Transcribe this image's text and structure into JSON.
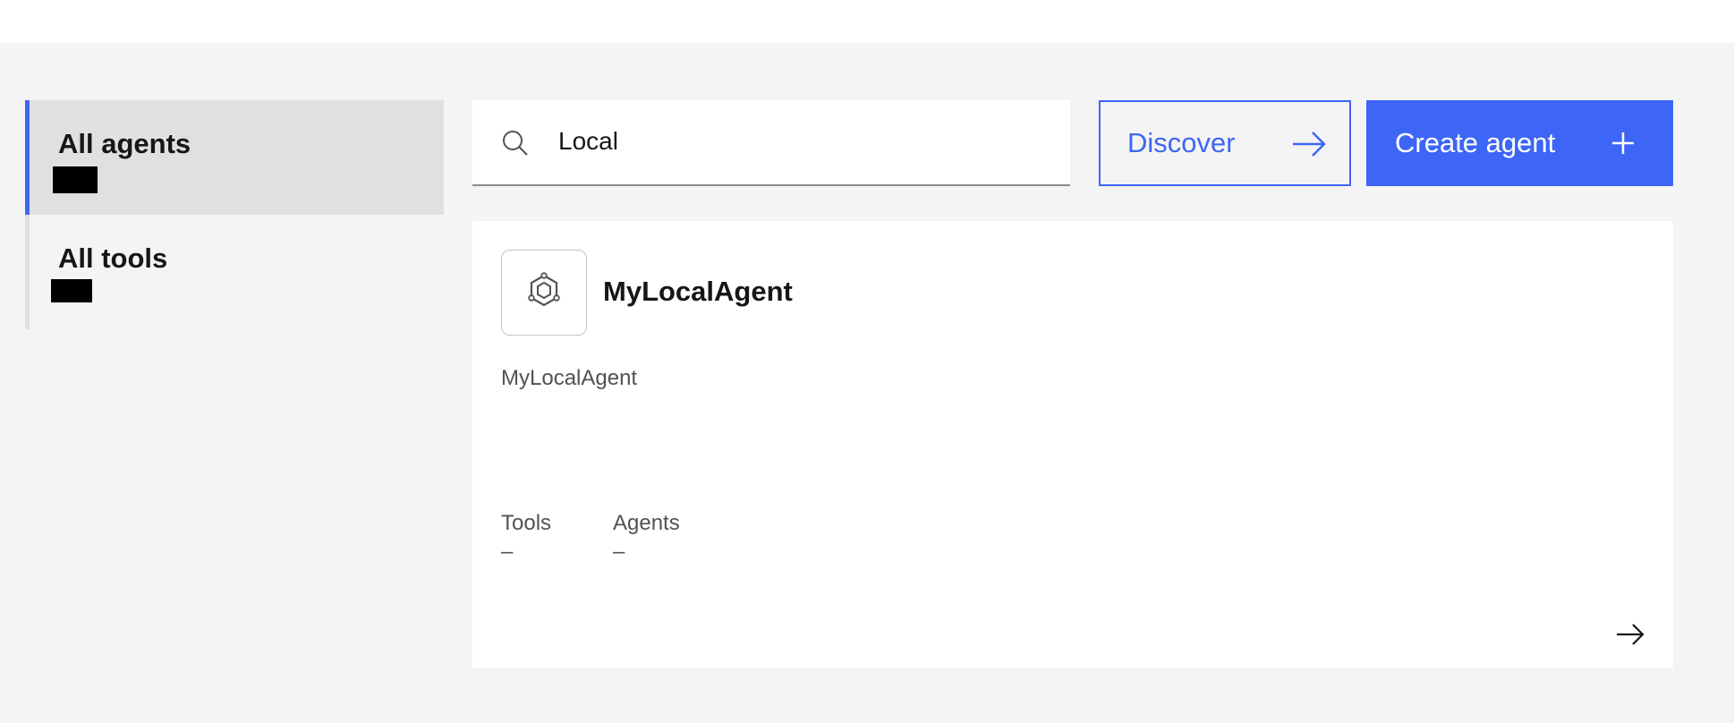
{
  "sidebar": {
    "items": [
      {
        "label": "All agents",
        "active": true
      },
      {
        "label": "All tools",
        "active": false
      }
    ]
  },
  "search": {
    "value": "Local",
    "icon": "search-icon"
  },
  "toolbar": {
    "discover_label": "Discover",
    "create_label": "Create agent"
  },
  "card": {
    "title": "MyLocalAgent",
    "description": "MyLocalAgent",
    "icon": "agent-hexagon-icon",
    "tools_label": "Tools",
    "tools_value": "–",
    "agents_label": "Agents",
    "agents_value": "–"
  },
  "colors": {
    "accent": "#3d66f6",
    "background": "#f4f4f4",
    "surface": "#ffffff",
    "active_nav": "#e0e0e0"
  }
}
